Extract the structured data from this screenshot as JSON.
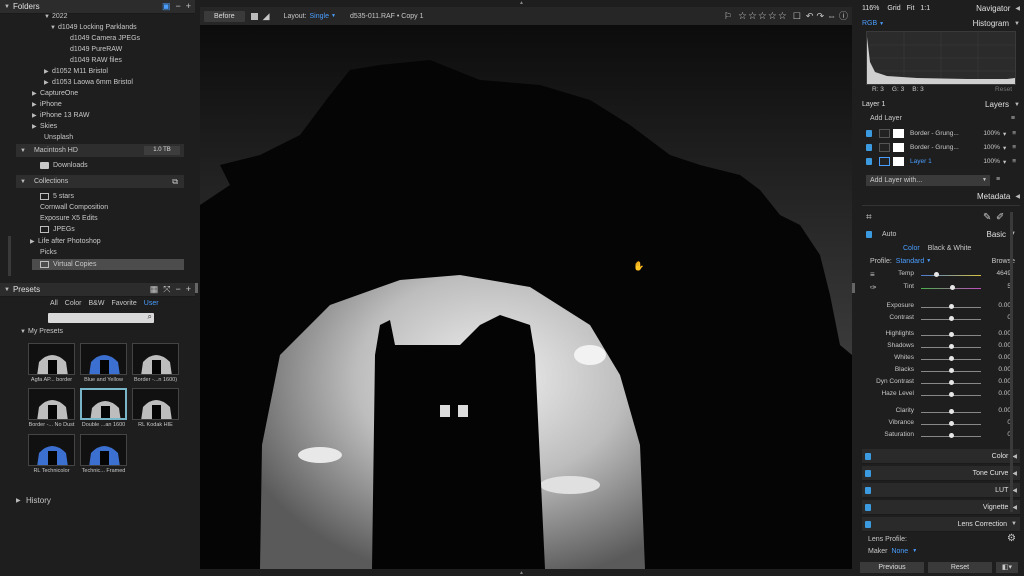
{
  "folders": {
    "title": "Folders",
    "items": [
      "2022",
      "d1049 Locking Parklands",
      "d1049 Camera JPEGs",
      "d1049 PureRAW",
      "d1049 RAW files",
      "d1052 M11 Bristol",
      "d1053 Laowa 6mm Bristol",
      "CaptureOne",
      "iPhone",
      "iPhone 13 RAW",
      "Skies",
      "Unsplash"
    ],
    "drive": {
      "name": "Macintosh HD",
      "capacity": "1.0 TB"
    },
    "downloads": "Downloads",
    "collections_title": "Collections",
    "collections": [
      "5 stars",
      "Cornwall Composition",
      "Exposure X5 Edits",
      "JPEGs",
      "Life after Photoshop",
      "Picks",
      "Virtual Copies"
    ]
  },
  "presets": {
    "title": "Presets",
    "tabs": [
      "All",
      "Color",
      "B&W",
      "Favorite",
      "User"
    ],
    "group": "My Presets",
    "items": [
      "Agfa AP... border",
      "Blue and Yellow",
      "Border -...n 1600)",
      "Border -... No Dust",
      "Double ...an 1600",
      "RL Kodak HIE",
      "RL Technicolor",
      "Technic... Framed"
    ]
  },
  "history": {
    "title": "History"
  },
  "toolbar": {
    "before": "Before",
    "layout_label": "Layout:",
    "layout_value": "Single",
    "filename": "d535-011.RAF • Copy 1",
    "stars": "☆☆☆☆☆"
  },
  "navigator": {
    "zoom": "116%",
    "grid": "Grid",
    "fit": "Fit",
    "one": "1:1",
    "title": "Navigator"
  },
  "histogram": {
    "mode": "RGB",
    "title": "Histogram",
    "r": "R: 3",
    "g": "G: 3",
    "b": "B: 3",
    "reset": "Reset"
  },
  "layers": {
    "current": "Layer 1",
    "title": "Layers",
    "add": "Add Layer",
    "items": [
      {
        "name": "Border - Grung...",
        "opacity": "100%"
      },
      {
        "name": "Border - Grung...",
        "opacity": "100%"
      },
      {
        "name": "Layer 1",
        "opacity": "100%"
      }
    ],
    "add_with": "Add Layer with..."
  },
  "metadata": {
    "title": "Metadata"
  },
  "basic": {
    "auto": "Auto",
    "title": "Basic",
    "color": "Color",
    "bw": "Black & White",
    "profile_label": "Profile:",
    "profile_value": "Standard",
    "browse": "Browse",
    "temp": {
      "label": "Temp",
      "value": "4649",
      "pos": 0.25
    },
    "tint": {
      "label": "Tint",
      "value": "5",
      "pos": 0.52
    },
    "sliders": [
      {
        "label": "Exposure",
        "value": "0.00",
        "pos": 0.5
      },
      {
        "label": "Contrast",
        "value": "0",
        "pos": 0.5
      },
      {
        "label": "Highlights",
        "value": "0.00",
        "pos": 0.5
      },
      {
        "label": "Shadows",
        "value": "0.00",
        "pos": 0.5
      },
      {
        "label": "Whites",
        "value": "0.00",
        "pos": 0.5
      },
      {
        "label": "Blacks",
        "value": "0.00",
        "pos": 0.5
      },
      {
        "label": "Dyn Contrast",
        "value": "0.00",
        "pos": 0.5
      },
      {
        "label": "Haze Level",
        "value": "0.00",
        "pos": 0.5
      },
      {
        "label": "Clarity",
        "value": "0.00",
        "pos": 0.5
      },
      {
        "label": "Vibrance",
        "value": "0",
        "pos": 0.5
      },
      {
        "label": "Saturation",
        "value": "0",
        "pos": 0.5
      }
    ]
  },
  "sections": [
    "Color",
    "Tone Curve",
    "LUT",
    "Vignette",
    "Lens Correction"
  ],
  "lens": {
    "profile_label": "Lens Profile:",
    "maker_label": "Maker",
    "maker_value": "None"
  },
  "bottom": {
    "previous": "Previous",
    "reset": "Reset"
  }
}
